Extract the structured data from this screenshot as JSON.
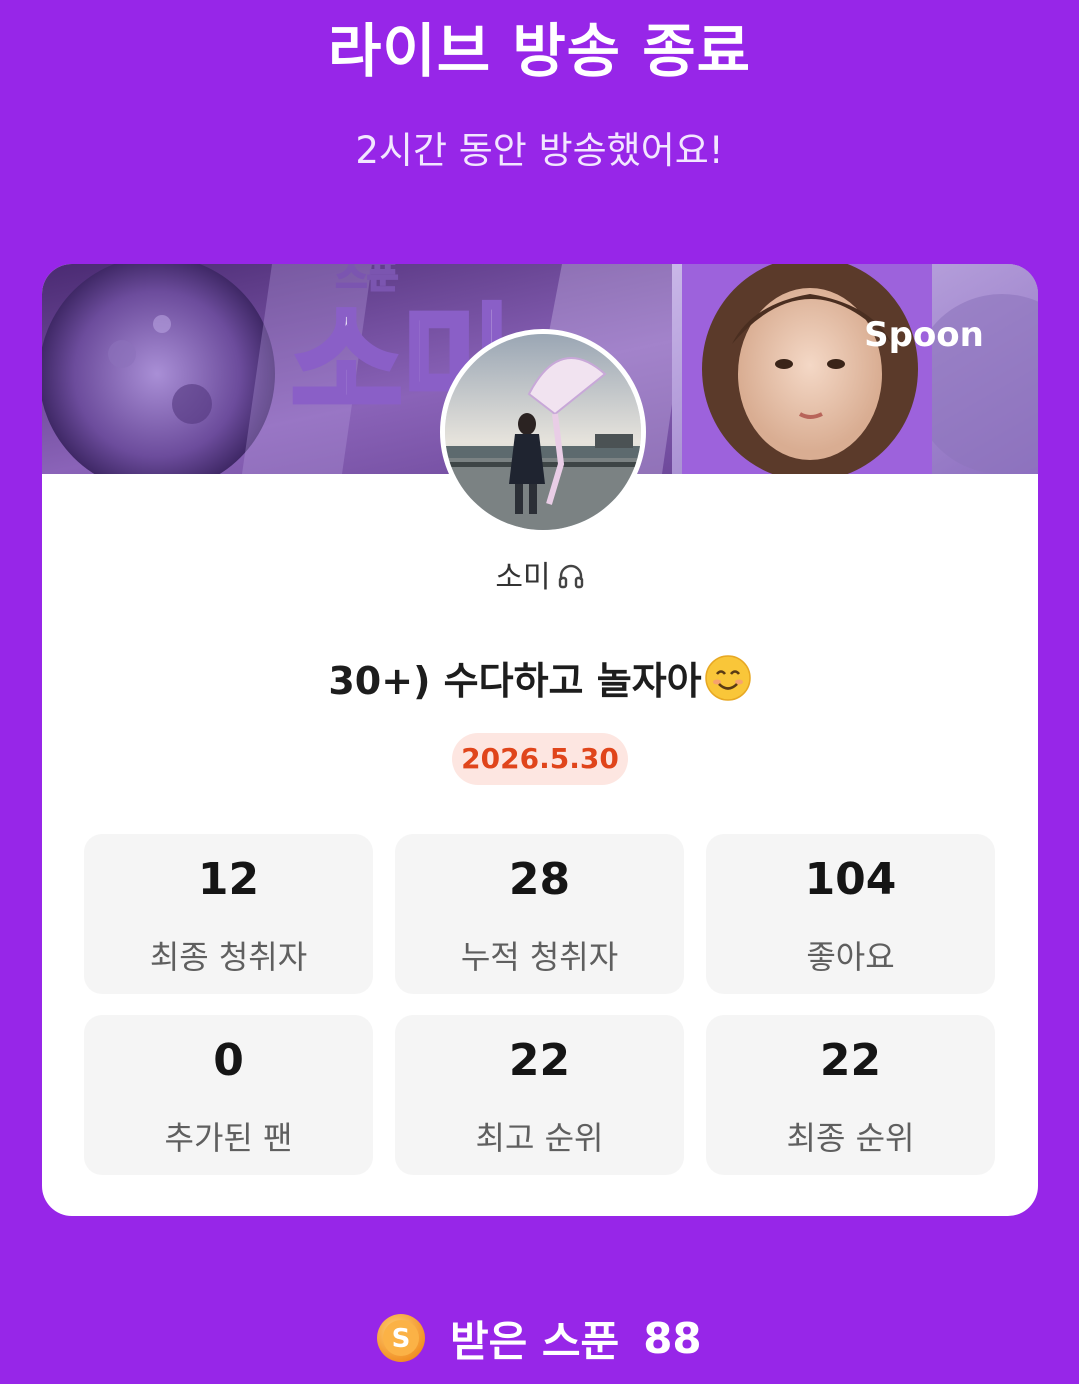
{
  "header": {
    "title": "라이브 방송 종료",
    "subtitle": "2시간 동안 방송했어요!"
  },
  "card": {
    "banner": {
      "text_small": "스푼",
      "text_large": "소미",
      "brand": "Spoon"
    },
    "username": "소미",
    "username_icon": "headset-icon",
    "live_title": "30+) 수다하고 놀자아",
    "live_title_emoji": "smiling-face-icon",
    "date": "2026.5.30",
    "stats": [
      {
        "value": "12",
        "label": "최종 청취자"
      },
      {
        "value": "28",
        "label": "누적 청취자"
      },
      {
        "value": "104",
        "label": "좋아요"
      },
      {
        "value": "0",
        "label": "추가된 팬"
      },
      {
        "value": "22",
        "label": "최고 순위"
      },
      {
        "value": "22",
        "label": "최종 순위"
      }
    ]
  },
  "footer": {
    "coin_icon": "spoon-coin-icon",
    "coin_letter": "S",
    "label": "받은 스푼",
    "count": "88"
  },
  "colors": {
    "background": "#9726e8",
    "card": "#ffffff",
    "stat_tile": "#f5f5f5",
    "date_badge_bg": "#fde6e1",
    "date_badge_text": "#e0451b",
    "coin": "#f79a2b"
  }
}
